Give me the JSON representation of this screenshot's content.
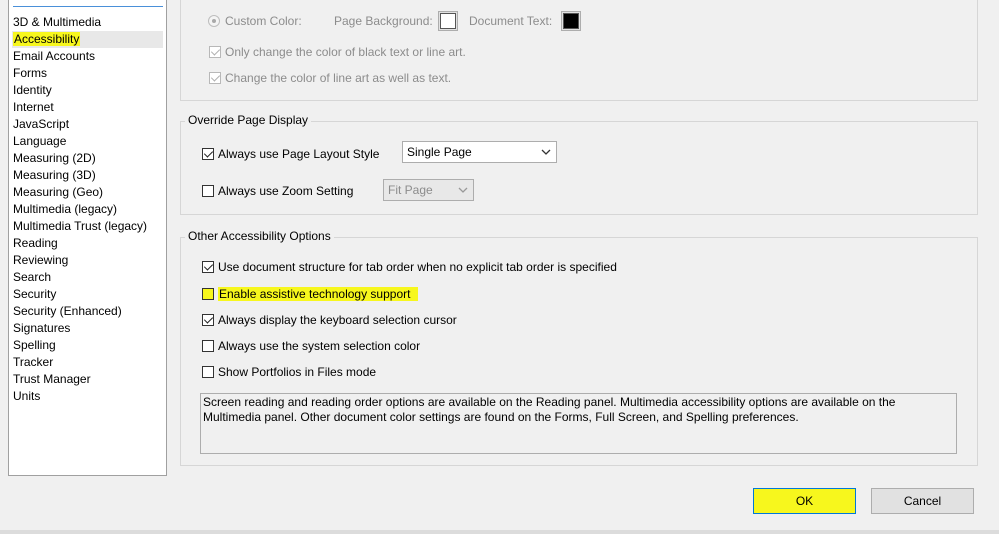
{
  "sidebar": {
    "items": [
      {
        "label": "3D & Multimedia"
      },
      {
        "label": "Accessibility"
      },
      {
        "label": "Email Accounts"
      },
      {
        "label": "Forms"
      },
      {
        "label": "Identity"
      },
      {
        "label": "Internet"
      },
      {
        "label": "JavaScript"
      },
      {
        "label": "Language"
      },
      {
        "label": "Measuring (2D)"
      },
      {
        "label": "Measuring (3D)"
      },
      {
        "label": "Measuring (Geo)"
      },
      {
        "label": "Multimedia (legacy)"
      },
      {
        "label": "Multimedia Trust (legacy)"
      },
      {
        "label": "Reading"
      },
      {
        "label": "Reviewing"
      },
      {
        "label": "Search"
      },
      {
        "label": "Security"
      },
      {
        "label": "Security (Enhanced)"
      },
      {
        "label": "Signatures"
      },
      {
        "label": "Spelling"
      },
      {
        "label": "Tracker"
      },
      {
        "label": "Trust Manager"
      },
      {
        "label": "Units"
      }
    ],
    "selected": "Accessibility"
  },
  "color_section": {
    "custom_color_label": "Custom Color:",
    "page_background_label": "Page Background:",
    "document_text_label": "Document Text:",
    "page_background_color": "#ffffff",
    "document_text_color": "#000000",
    "only_change_black_label": "Only change the color of black text or line art.",
    "change_line_art_label": "Change the color of line art as well as text."
  },
  "override": {
    "legend": "Override Page Display",
    "page_layout_label": "Always use Page Layout Style",
    "page_layout_value": "Single Page",
    "zoom_label": "Always use Zoom Setting",
    "zoom_value": "Fit Page"
  },
  "other": {
    "legend": "Other Accessibility Options",
    "options": [
      {
        "label": "Use document structure for tab order when no explicit tab order is specified",
        "checked": true
      },
      {
        "label": "Enable assistive technology support",
        "checked": false
      },
      {
        "label": "Always display the keyboard selection cursor",
        "checked": true
      },
      {
        "label": "Always use the system selection color",
        "checked": false
      },
      {
        "label": "Show Portfolios in Files mode",
        "checked": false
      }
    ],
    "info_text": "Screen reading and reading order options are available on the Reading panel. Multimedia accessibility options are available on the Multimedia panel. Other document color settings are found on the Forms, Full Screen, and Spelling preferences."
  },
  "buttons": {
    "ok": "OK",
    "cancel": "Cancel"
  },
  "colors": {
    "highlight": "#f7f71d",
    "ok_border": "#0078d7"
  }
}
